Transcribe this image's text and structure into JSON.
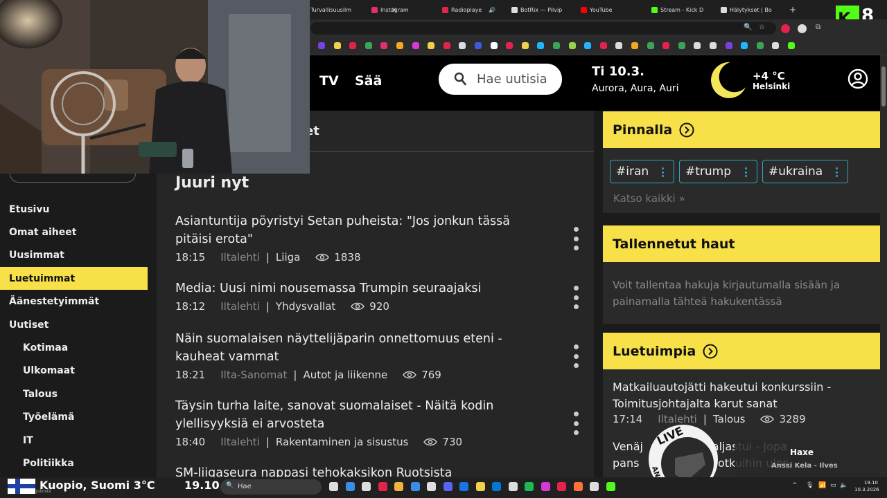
{
  "browser": {
    "tabs": [
      {
        "title": "Turvallisuusilm",
        "color": "#ffffff"
      },
      {
        "title": "Instagram",
        "color": "#e1306c"
      },
      {
        "title": "Radioplaye",
        "color": "#e5224b"
      },
      {
        "title": "BotRix — Pilvip",
        "color": "#ffffff"
      },
      {
        "title": "YouTube",
        "color": "#ff0000"
      },
      {
        "title": "Stream - Kick D",
        "color": "#53fc18"
      },
      {
        "title": "Hälytykset | Bo",
        "color": "#ffffff"
      }
    ],
    "new_tab": "+",
    "kick_letter": "K",
    "kick_number": "8"
  },
  "header": {
    "nav_tv": "TV",
    "nav_saa": "Sää",
    "search_placeholder": "Hae uutisia",
    "date": "Ti 10.3.",
    "name_days": "Aurora, Aura, Auri",
    "temperature": "+4 °C",
    "city": "Helsinki"
  },
  "sidebar": {
    "items": [
      {
        "label": "Etusivu",
        "sub": false,
        "active": false
      },
      {
        "label": "Omat aiheet",
        "sub": false,
        "active": false
      },
      {
        "label": "Uusimmat",
        "sub": false,
        "active": false
      },
      {
        "label": "Luetuimmat",
        "sub": false,
        "active": true
      },
      {
        "label": "Äänestetyimmät",
        "sub": false,
        "active": false
      },
      {
        "label": "Uutiset",
        "sub": false,
        "active": false
      },
      {
        "label": "Kotimaa",
        "sub": true,
        "active": false
      },
      {
        "label": "Ulkomaat",
        "sub": true,
        "active": false
      },
      {
        "label": "Talous",
        "sub": true,
        "active": false
      },
      {
        "label": "Työelämä",
        "sub": true,
        "active": false
      },
      {
        "label": "IT",
        "sub": true,
        "active": false
      },
      {
        "label": "Politiikka",
        "sub": true,
        "active": false
      }
    ]
  },
  "main": {
    "top_fragment": "et",
    "section_title": "Juuri nyt",
    "articles": [
      {
        "title": "Asiantuntija pöyristyi Setan puheista: \"Jos jonkun tässä pitäisi erota\"",
        "time": "18:15",
        "source": "Iltalehti",
        "category": "Liiga",
        "views": "1838"
      },
      {
        "title": "Media: Uusi nimi nousemassa Trumpin seuraajaksi",
        "time": "18:12",
        "source": "Iltalehti",
        "category": "Yhdysvallat",
        "views": "920"
      },
      {
        "title": "Näin suomalaisen näyttelijäparin onnettomuus eteni - kauheat vammat",
        "time": "18:21",
        "source": "Ilta-Sanomat",
        "category": "Autot ja liikenne",
        "views": "769"
      },
      {
        "title": "Täysin turha laite, sanovat suomalaiset - Näitä kodin ylellisyyksiä ei arvosteta",
        "time": "18:40",
        "source": "Iltalehti",
        "category": "Rakentaminen ja sisustus",
        "views": "730"
      },
      {
        "title": "SM-liigaseura nappasi tehokaksikon Ruotsista"
      }
    ]
  },
  "right": {
    "pinnalla_title": "Pinnalla",
    "tags": [
      "#iran",
      "#trump",
      "#ukraina"
    ],
    "see_all": "Katso kaikki »",
    "saved_title": "Tallennetut haut",
    "saved_text": "Voit tallentaa hakuja kirjautumalla sisään ja painamalla tähteä hakukentässä",
    "popular_title": "Luetuimpia",
    "popular": {
      "title": "Matkailuautojätti hakeutui konkurssiin - Toimitusjohtajalta karut sanat",
      "time": "17:14",
      "source": "Iltalehti",
      "category": "Talous",
      "views": "3289"
    },
    "fragment_line1": "Venäj             us paljastui - Jopa",
    "fragment_line2": "pans              kas potkuihin ulos,"
  },
  "overlay": {
    "song_title": "Haxe",
    "song_artist": "Anssi Kela - Ilves",
    "badge_text": "LIVE",
    "badge_sub": "ANSSI"
  },
  "taskbar": {
    "location": "Kuopio, Suomi 3°C",
    "location_sub": "pilvistä",
    "time_big": "19.10",
    "search_placeholder": "Hae",
    "clock_time": "19.10",
    "clock_date": "10.3.2026"
  },
  "colors": {
    "accent_yellow": "#f7e048",
    "tag_border": "#2ea8c4",
    "kick_green": "#53fc18"
  }
}
